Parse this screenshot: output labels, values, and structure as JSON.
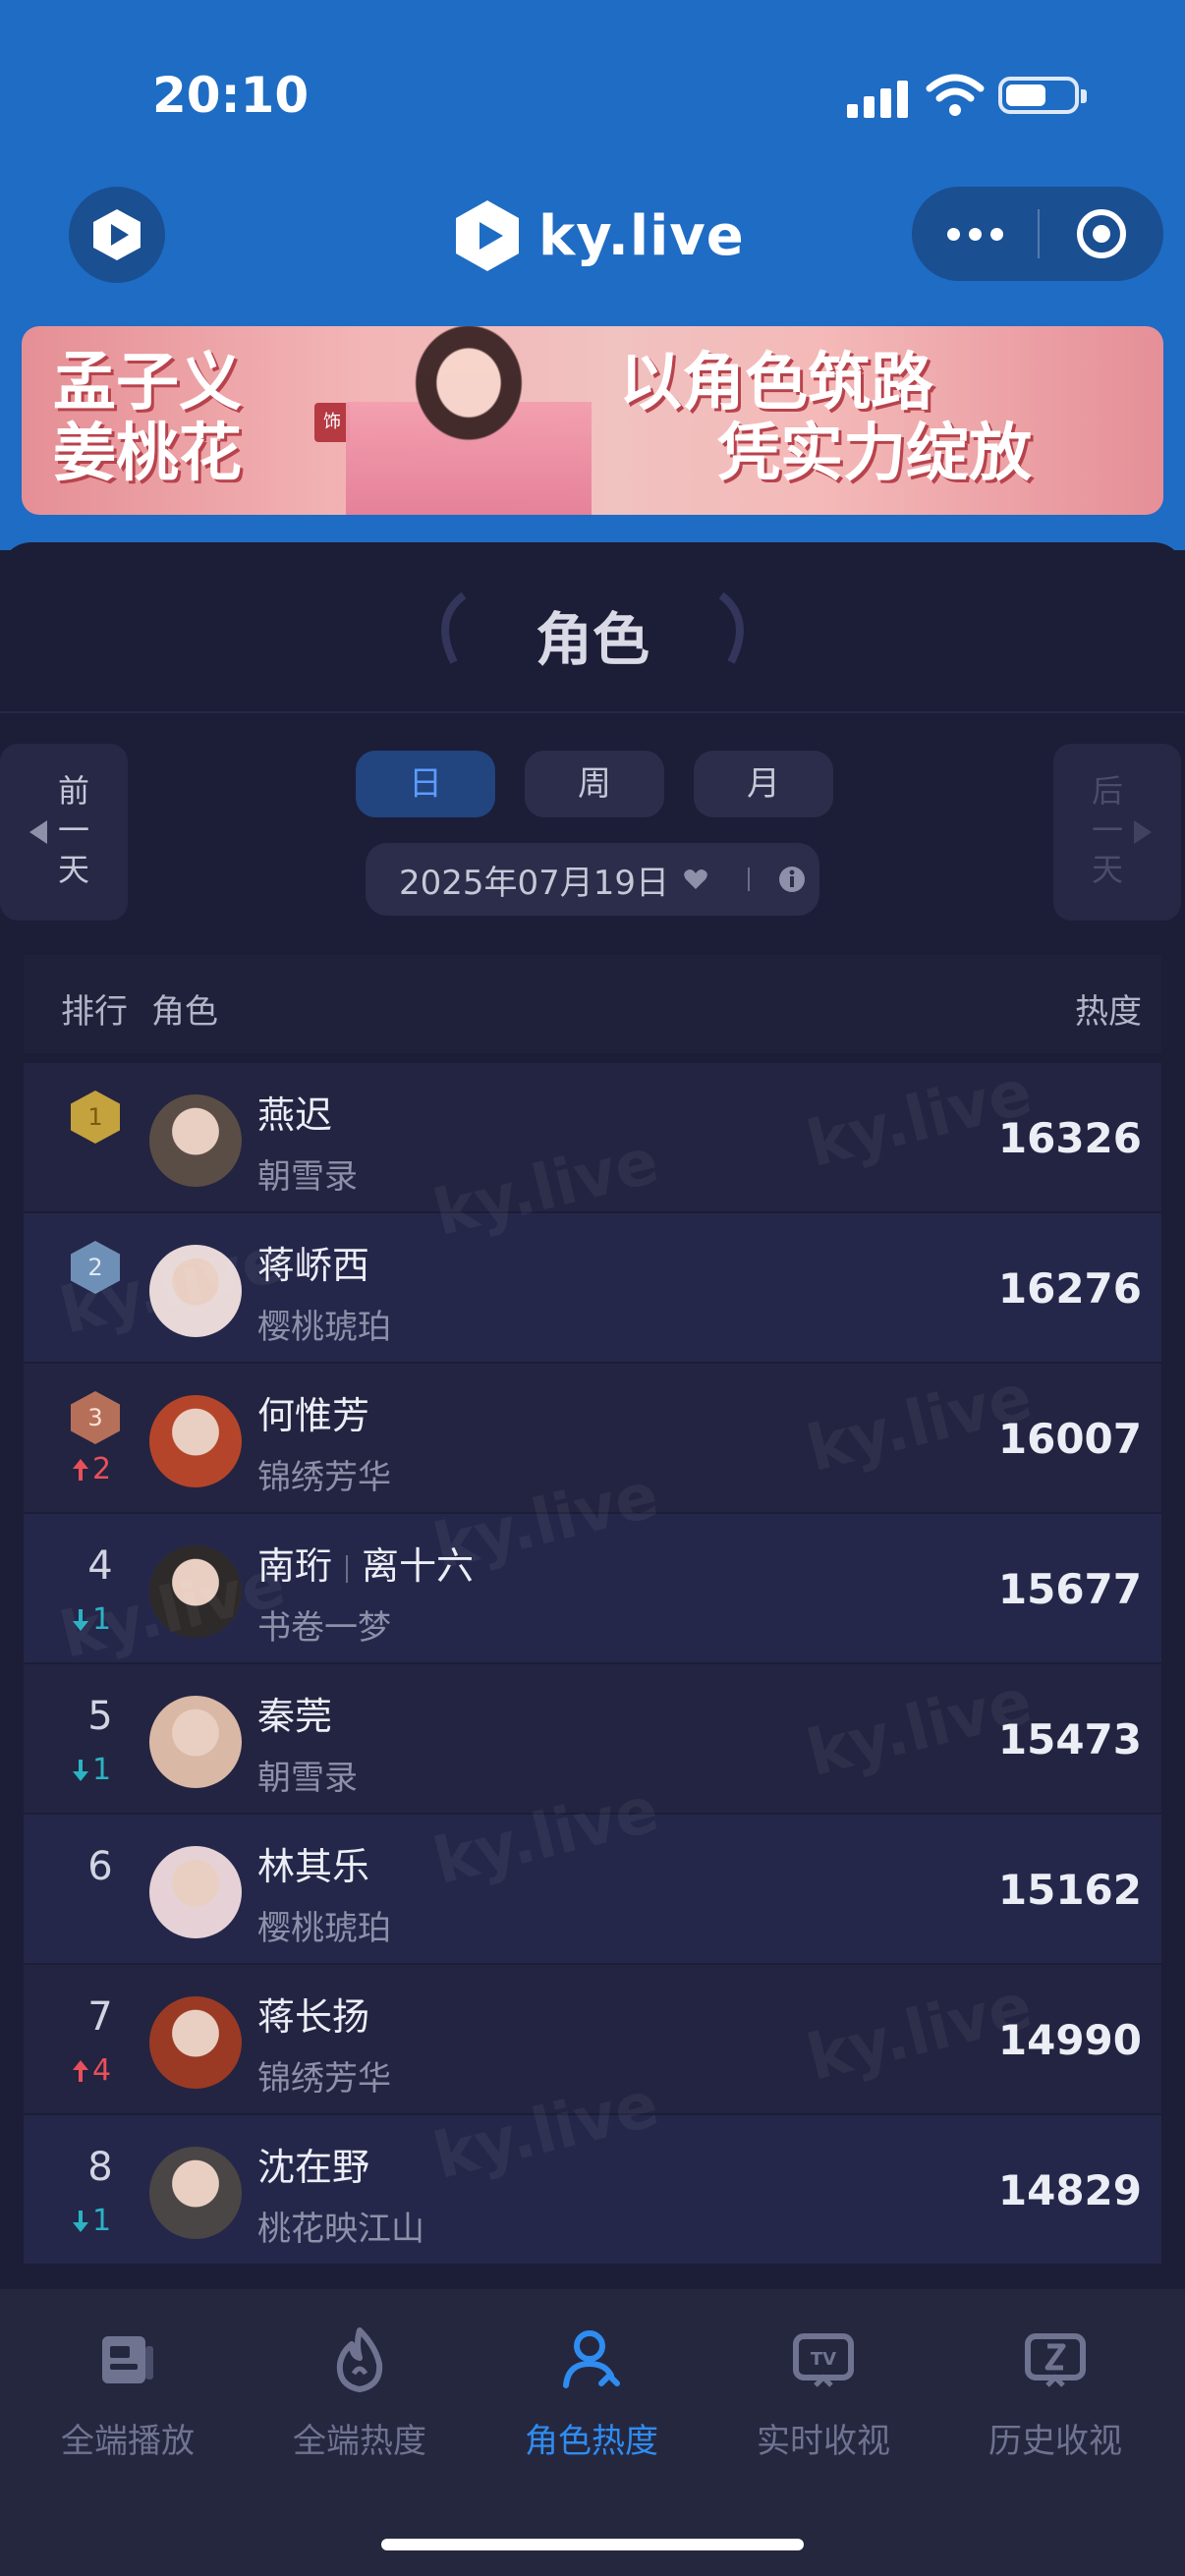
{
  "status_bar": {
    "time": "20:10"
  },
  "nav": {
    "brand": "ky.live"
  },
  "banner": {
    "left_lines": [
      "孟子义",
      "姜桃花"
    ],
    "right_lines": [
      "以角色筑路",
      "凭实力绽放"
    ],
    "seal": "饰"
  },
  "panel": {
    "title": "角色",
    "prev_day": "前一天",
    "next_day": "后一天",
    "tabs": [
      {
        "label": "日",
        "active": true
      },
      {
        "label": "周",
        "active": false
      },
      {
        "label": "月",
        "active": false
      }
    ],
    "date": "2025年07月19日"
  },
  "table": {
    "headers": {
      "rank": "排行",
      "role": "角色",
      "heat": "热度"
    },
    "rows": [
      {
        "rank": "1",
        "medal": "gold",
        "change_dir": "",
        "change": "",
        "name": "燕迟",
        "name2": "",
        "show": "朝雪录",
        "heat": "16326",
        "avatar_color": "#5a4d45"
      },
      {
        "rank": "2",
        "medal": "silver",
        "change_dir": "",
        "change": "",
        "name": "蒋峤西",
        "name2": "",
        "show": "樱桃琥珀",
        "heat": "16276",
        "avatar_color": "#e8d8d8"
      },
      {
        "rank": "3",
        "medal": "bronze",
        "change_dir": "up",
        "change": "2",
        "name": "何惟芳",
        "name2": "",
        "show": "锦绣芳华",
        "heat": "16007",
        "avatar_color": "#b5452a"
      },
      {
        "rank": "4",
        "medal": "",
        "change_dir": "down",
        "change": "1",
        "name": "南珩",
        "name2": "离十六",
        "show": "书卷一梦",
        "heat": "15677",
        "avatar_color": "#2e2a2a"
      },
      {
        "rank": "5",
        "medal": "",
        "change_dir": "down",
        "change": "1",
        "name": "秦莞",
        "name2": "",
        "show": "朝雪录",
        "heat": "15473",
        "avatar_color": "#d9b8a6"
      },
      {
        "rank": "6",
        "medal": "",
        "change_dir": "",
        "change": "",
        "name": "林其乐",
        "name2": "",
        "show": "樱桃琥珀",
        "heat": "15162",
        "avatar_color": "#e6d2d6"
      },
      {
        "rank": "7",
        "medal": "",
        "change_dir": "up",
        "change": "4",
        "name": "蒋长扬",
        "name2": "",
        "show": "锦绣芳华",
        "heat": "14990",
        "avatar_color": "#9a3a24"
      },
      {
        "rank": "8",
        "medal": "",
        "change_dir": "down",
        "change": "1",
        "name": "沈在野",
        "name2": "",
        "show": "桃花映江山",
        "heat": "14829",
        "avatar_color": "#4a4646"
      }
    ]
  },
  "watermark": "ky.live",
  "tabbar": {
    "items": [
      {
        "label": "全端播放",
        "icon": "play-panel-icon",
        "active": false
      },
      {
        "label": "全端热度",
        "icon": "flame-icon",
        "active": false
      },
      {
        "label": "角色热度",
        "icon": "user-icon",
        "active": true
      },
      {
        "label": "实时收视",
        "icon": "tv-icon",
        "active": false
      },
      {
        "label": "历史收视",
        "icon": "history-icon",
        "active": false
      }
    ]
  },
  "colors": {
    "accent": "#2f8cf0",
    "header_bg": "#1f6cc4",
    "bg": "#1c1d36",
    "up": "#e8505a",
    "down": "#2bb3c4"
  }
}
